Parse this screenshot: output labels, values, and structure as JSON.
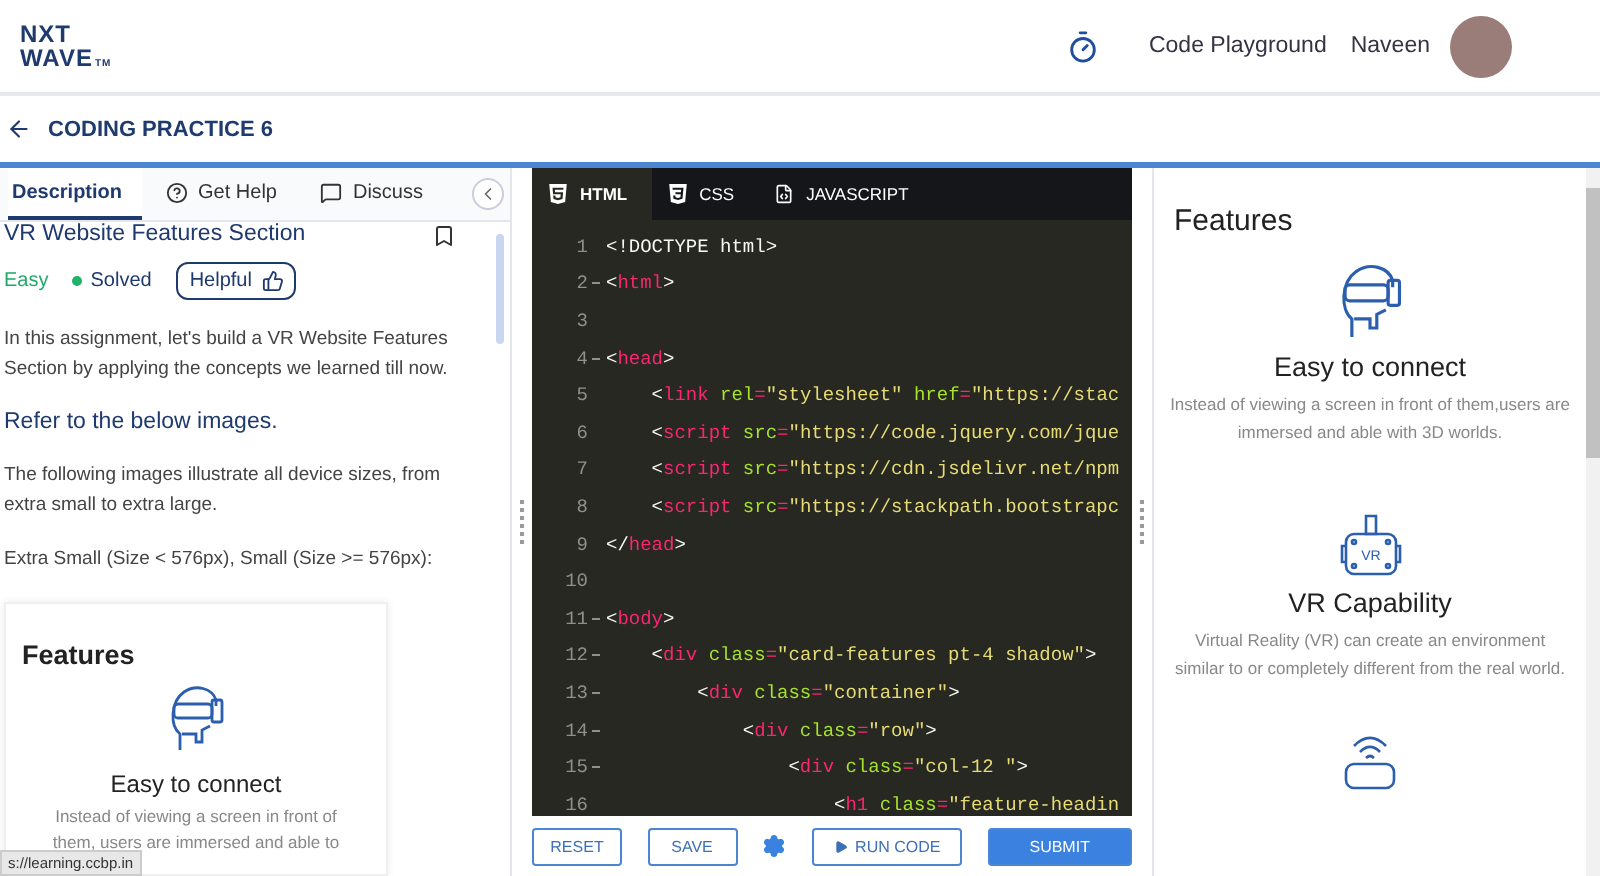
{
  "header": {
    "logo": {
      "line_1": "NXT",
      "line_2": "WAVE",
      "mark": "TM"
    },
    "links": [
      "Code Playground"
    ],
    "user": {
      "name": "Naveen"
    }
  },
  "subheader": {
    "title": "CODING PRACTICE 6"
  },
  "left_panel": {
    "tabs": [
      {
        "label": "Description",
        "selected": true
      },
      {
        "label": "Get Help",
        "selected": false
      },
      {
        "label": "Discuss",
        "selected": false
      }
    ],
    "problem": {
      "title": "VR Website Features Section",
      "bookmarked": false,
      "difficulty": "Easy",
      "status": "Solved",
      "helpful_button": "Helpful"
    },
    "paragraphs": [
      {
        "kind": "text",
        "text": "In this assignment, let's build a VR Website Features Section by applying the concepts we learned till now."
      },
      {
        "kind": "heading",
        "text": "Refer to the below images."
      },
      {
        "kind": "text",
        "text": "The following images illustrate all device sizes, from extra small to extra large."
      },
      {
        "kind": "text",
        "text": "Extra Small (Size < 576px), Small (Size >= 576px):"
      }
    ],
    "image": {
      "heading": "Features",
      "items": [
        {
          "title": "Easy to connect",
          "description": "Instead of viewing a screen in front of them, users are immersed and able to"
        }
      ]
    },
    "status_url": "s://learning.ccbp.in"
  },
  "editor": {
    "tabs": [
      {
        "label": "HTML",
        "selected": true
      },
      {
        "label": "CSS",
        "selected": false
      },
      {
        "label": "JAVASCRIPT",
        "selected": false
      }
    ],
    "lines": [
      {
        "number": "1",
        "foldable": false,
        "tokens": [
          {
            "kind": "plain",
            "text": "<!DOCTYPE html>"
          }
        ]
      },
      {
        "number": "2",
        "foldable": true,
        "tokens": [
          {
            "kind": "plain",
            "text": "<"
          },
          {
            "kind": "tag",
            "text": "html"
          },
          {
            "kind": "plain",
            "text": ">"
          }
        ]
      },
      {
        "number": "3",
        "foldable": false
      },
      {
        "number": "4",
        "foldable": true,
        "tokens": [
          {
            "kind": "plain",
            "text": "<"
          },
          {
            "kind": "tag",
            "text": "head"
          },
          {
            "kind": "plain",
            "text": ">"
          }
        ]
      },
      {
        "number": "5",
        "foldable": false,
        "tokens": [
          {
            "kind": "plain",
            "text": "    <"
          },
          {
            "kind": "tag",
            "text": "link"
          },
          {
            "kind": "attr",
            "text": " rel"
          },
          {
            "kind": "tag",
            "text": "="
          },
          {
            "kind": "string",
            "text": "\"stylesheet\""
          },
          {
            "kind": "attr",
            "text": " href"
          },
          {
            "kind": "tag",
            "text": "="
          },
          {
            "kind": "string",
            "text": "\"https://stac"
          }
        ]
      },
      {
        "number": "6",
        "foldable": false,
        "tokens": [
          {
            "kind": "plain",
            "text": "    <"
          },
          {
            "kind": "tag",
            "text": "script"
          },
          {
            "kind": "attr",
            "text": " src"
          },
          {
            "kind": "tag",
            "text": "="
          },
          {
            "kind": "string",
            "text": "\"https://code.jquery.com/jque"
          }
        ]
      },
      {
        "number": "7",
        "foldable": false,
        "tokens": [
          {
            "kind": "plain",
            "text": "    <"
          },
          {
            "kind": "tag",
            "text": "script"
          },
          {
            "kind": "attr",
            "text": " src"
          },
          {
            "kind": "tag",
            "text": "="
          },
          {
            "kind": "string",
            "text": "\"https://cdn.jsdelivr.net/npm"
          }
        ]
      },
      {
        "number": "8",
        "foldable": false,
        "tokens": [
          {
            "kind": "plain",
            "text": "    <"
          },
          {
            "kind": "tag",
            "text": "script"
          },
          {
            "kind": "attr",
            "text": " src"
          },
          {
            "kind": "tag",
            "text": "="
          },
          {
            "kind": "string",
            "text": "\"https://stackpath.bootstrapc"
          }
        ]
      },
      {
        "number": "9",
        "foldable": false,
        "tokens": [
          {
            "kind": "plain",
            "text": "</"
          },
          {
            "kind": "tag",
            "text": "head"
          },
          {
            "kind": "plain",
            "text": ">"
          }
        ]
      },
      {
        "number": "10",
        "foldable": false
      },
      {
        "number": "11",
        "foldable": true,
        "tokens": [
          {
            "kind": "plain",
            "text": "<"
          },
          {
            "kind": "tag",
            "text": "body"
          },
          {
            "kind": "plain",
            "text": ">"
          }
        ]
      },
      {
        "number": "12",
        "foldable": true,
        "tokens": [
          {
            "kind": "plain",
            "text": "    <"
          },
          {
            "kind": "tag",
            "text": "div"
          },
          {
            "kind": "attr",
            "text": " class"
          },
          {
            "kind": "tag",
            "text": "="
          },
          {
            "kind": "string",
            "text": "\"card-features pt-4 shadow\""
          },
          {
            "kind": "plain",
            "text": ">"
          }
        ]
      },
      {
        "number": "13",
        "foldable": true,
        "tokens": [
          {
            "kind": "plain",
            "text": "        <"
          },
          {
            "kind": "tag",
            "text": "div"
          },
          {
            "kind": "attr",
            "text": " class"
          },
          {
            "kind": "tag",
            "text": "="
          },
          {
            "kind": "string",
            "text": "\"container\""
          },
          {
            "kind": "plain",
            "text": ">"
          }
        ]
      },
      {
        "number": "14",
        "foldable": true,
        "tokens": [
          {
            "kind": "plain",
            "text": "            <"
          },
          {
            "kind": "tag",
            "text": "div"
          },
          {
            "kind": "attr",
            "text": " class"
          },
          {
            "kind": "tag",
            "text": "="
          },
          {
            "kind": "string",
            "text": "\"row\""
          },
          {
            "kind": "plain",
            "text": ">"
          }
        ]
      },
      {
        "number": "15",
        "foldable": true,
        "tokens": [
          {
            "kind": "plain",
            "text": "                <"
          },
          {
            "kind": "tag",
            "text": "div"
          },
          {
            "kind": "attr",
            "text": " class"
          },
          {
            "kind": "tag",
            "text": "="
          },
          {
            "kind": "string",
            "text": "\"col-12 \""
          },
          {
            "kind": "plain",
            "text": ">"
          }
        ]
      },
      {
        "number": "16",
        "foldable": false,
        "tokens": [
          {
            "kind": "plain",
            "text": "                    <"
          },
          {
            "kind": "tag",
            "text": "h1"
          },
          {
            "kind": "attr",
            "text": " class"
          },
          {
            "kind": "tag",
            "text": "="
          },
          {
            "kind": "string",
            "text": "\"feature-headin"
          }
        ]
      }
    ],
    "buttons": [
      {
        "kind": "outline",
        "label": "RESET"
      },
      {
        "kind": "outline",
        "label": "SAVE"
      },
      {
        "kind": "settings"
      },
      {
        "kind": "run",
        "label": "RUN CODE"
      },
      {
        "kind": "primary",
        "label": "SUBMIT"
      }
    ]
  },
  "preview": {
    "heading": "Features",
    "items": [
      {
        "title": "Easy to connect",
        "description": "Instead of viewing a screen in front of them,users are immersed and able with 3D worlds."
      },
      {
        "icon_text": "VR",
        "title": "VR Capability",
        "description": "Virtual Reality (VR) can create an environment similar to or completely different from the real world."
      }
    ]
  }
}
